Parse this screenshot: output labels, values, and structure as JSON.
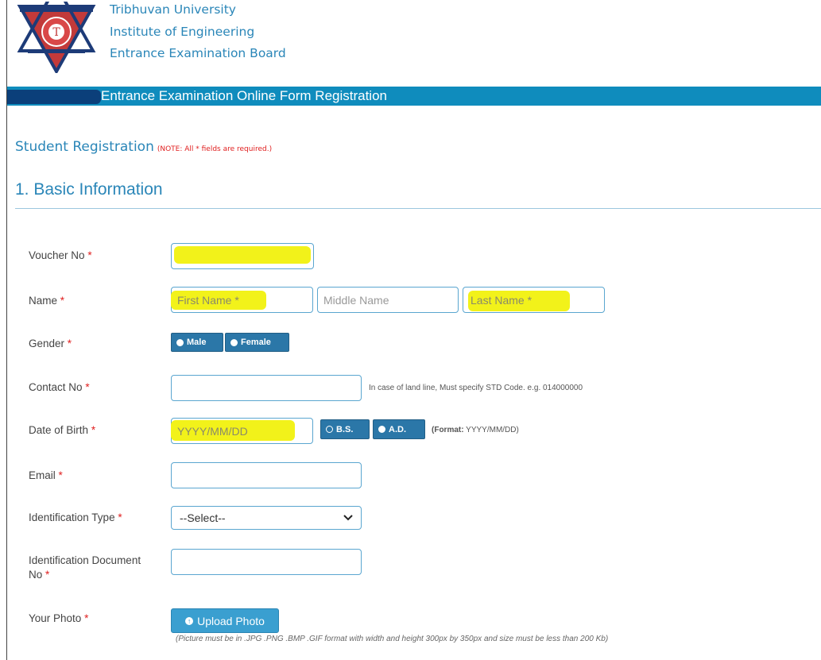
{
  "header": {
    "line1": "Tribhuvan University",
    "line2": "Institute of Engineering",
    "line3": "Entrance Examination Board",
    "banner_title": "Entrance Examination Online Form Registration"
  },
  "page": {
    "student_title": "Student Registration",
    "note": "(NOTE: All * fields are required.)",
    "section_title": "1. Basic Information",
    "required_mark": "*"
  },
  "form": {
    "voucher_label": "Voucher No",
    "name_label": "Name",
    "first_name_placeholder": "First Name *",
    "middle_name_placeholder": "Middle Name",
    "last_name_placeholder": "Last Name *",
    "gender_label": "Gender",
    "gender_male": "Male",
    "gender_female": "Female",
    "contact_label": "Contact No",
    "contact_hint": "In case of land line, Must specify STD Code. e.g. 014000000",
    "dob_label": "Date of Birth",
    "dob_placeholder": "YYYY/MM/DD",
    "dob_bs": "B.S.",
    "dob_ad": "A.D.",
    "dob_format_prefix": "(Format:",
    "dob_format_value": " YYYY/MM/DD)",
    "email_label": "Email",
    "id_type_label": "Identification Type",
    "id_type_selected": "--Select--",
    "id_doc_label_line1": "Identification Document",
    "id_doc_label_line2": "No",
    "photo_label": "Your Photo",
    "upload_button": "Upload Photo",
    "photo_note": "(Picture must be in .JPG .PNG .BMP .GIF format with width and height 300px by 350px and size must be less than 200 Kb)"
  },
  "colors": {
    "accent": "#2a86b8",
    "banner": "#0f8cbd",
    "highlight": "#f2f21a",
    "required": "#e02020",
    "button": "#2b77a8"
  }
}
